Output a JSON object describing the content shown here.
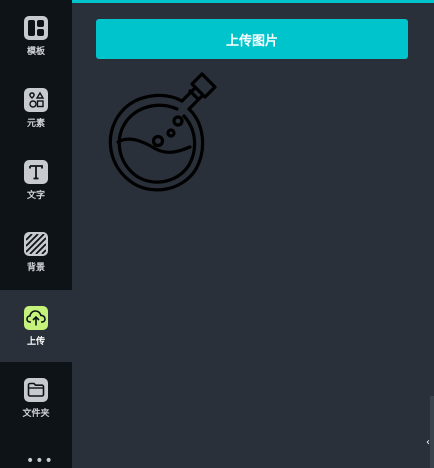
{
  "sidebar": {
    "items": [
      {
        "label": "模板",
        "icon": "template-icon"
      },
      {
        "label": "元素",
        "icon": "elements-icon"
      },
      {
        "label": "文字",
        "icon": "text-icon"
      },
      {
        "label": "背景",
        "icon": "background-icon"
      },
      {
        "label": "上传",
        "icon": "upload-cloud-icon",
        "active": true
      },
      {
        "label": "文件夹",
        "icon": "folder-icon"
      }
    ],
    "more": "•••"
  },
  "panel": {
    "upload_button_label": "上传图片",
    "illustration": "potion-flask-illustration"
  },
  "colors": {
    "accent": "#00c4cc",
    "sidebar_bg": "#0e1318",
    "panel_bg": "#293039",
    "active_icon_bg": "#c4f27a"
  },
  "collapse_glyph": "‹"
}
